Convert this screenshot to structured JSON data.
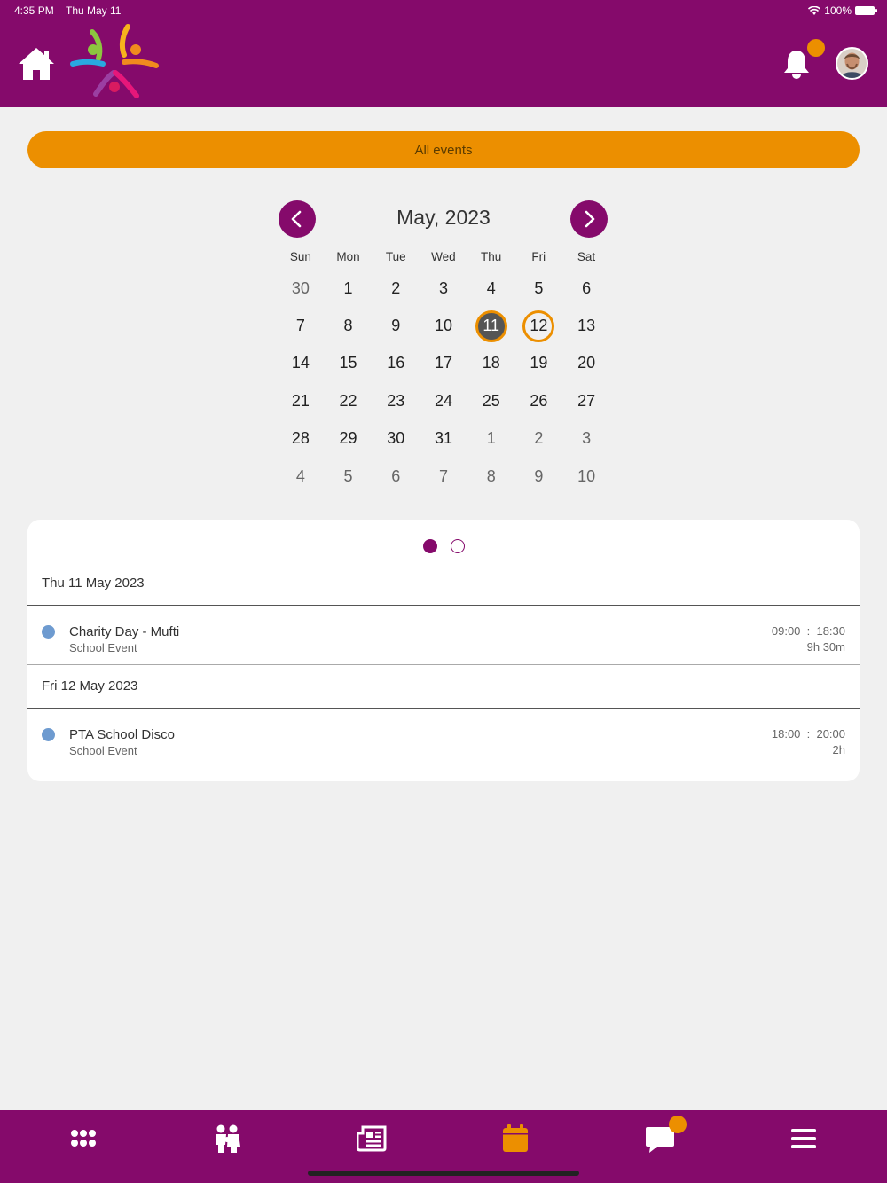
{
  "status_bar": {
    "time": "4:35 PM",
    "date": "Thu May 11",
    "battery": "100%"
  },
  "header": {
    "home_icon": "home-icon",
    "notification_icon": "bell-icon",
    "avatar_icon": "user-avatar"
  },
  "filter": {
    "label": "All events"
  },
  "calendar": {
    "title": "May, 2023",
    "weekdays": [
      "Sun",
      "Mon",
      "Tue",
      "Wed",
      "Thu",
      "Fri",
      "Sat"
    ],
    "weeks": [
      [
        "30",
        "1",
        "2",
        "3",
        "4",
        "5",
        "6"
      ],
      [
        "7",
        "8",
        "9",
        "10",
        "11",
        "12",
        "13"
      ],
      [
        "14",
        "15",
        "16",
        "17",
        "18",
        "19",
        "20"
      ],
      [
        "21",
        "22",
        "23",
        "24",
        "25",
        "26",
        "27"
      ],
      [
        "28",
        "29",
        "30",
        "31",
        "1",
        "2",
        "3"
      ],
      [
        "4",
        "5",
        "6",
        "7",
        "8",
        "9",
        "10"
      ]
    ],
    "today": "11",
    "selected": "12"
  },
  "events": {
    "pages": 2,
    "current_page": 1,
    "groups": [
      {
        "date": "Thu 11 May 2023",
        "items": [
          {
            "title": "Charity Day - Mufti",
            "category": "School Event",
            "time": "09:00  :  18:30",
            "duration": "9h 30m"
          }
        ]
      },
      {
        "date": "Fri 12 May 2023",
        "items": [
          {
            "title": "PTA School Disco",
            "category": "School Event",
            "time": "18:00  :  20:00",
            "duration": "2h"
          }
        ]
      }
    ]
  },
  "tabbar": {
    "tabs": [
      "apps-grid-icon",
      "people-icon",
      "newspaper-icon",
      "calendar-icon",
      "chat-icon",
      "menu-icon"
    ],
    "active": "calendar-icon"
  },
  "colors": {
    "brand": "#850a6b",
    "accent": "#ec8f00",
    "event_dot": "#6e9bd0"
  }
}
